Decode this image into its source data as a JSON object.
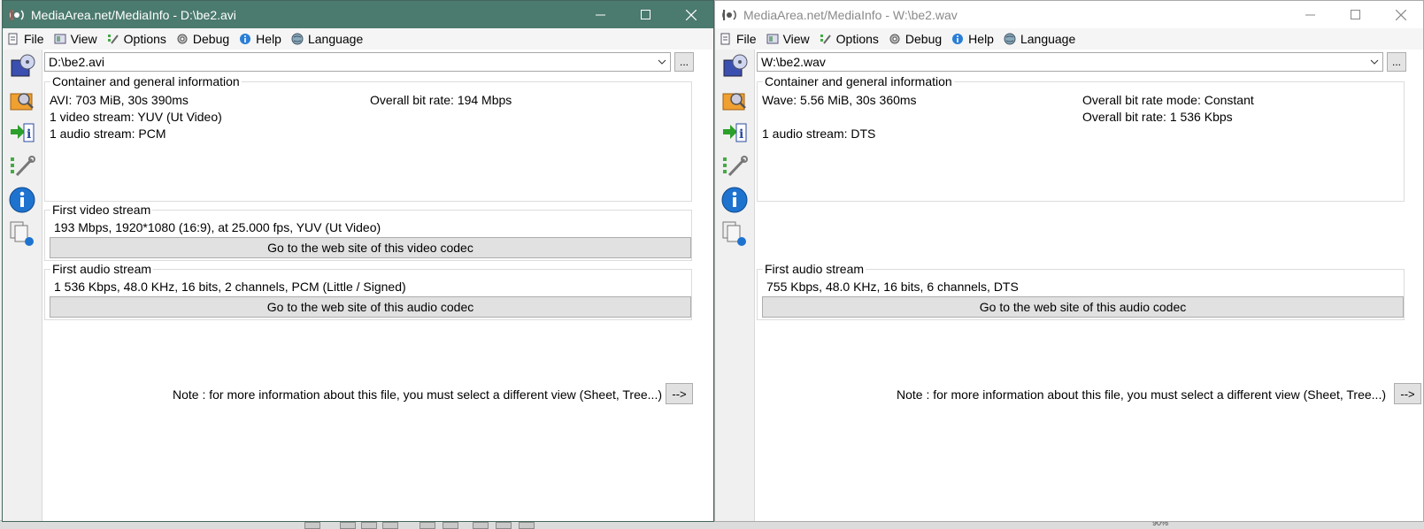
{
  "left_window": {
    "title": "MediaArea.net/MediaInfo - D:\\be2.avi",
    "menu": {
      "file": "File",
      "view": "View",
      "options": "Options",
      "debug": "Debug",
      "help": "Help",
      "language": "Language"
    },
    "file_combo": "D:\\be2.avi",
    "dots": "...",
    "general": {
      "title": "Container and general information",
      "line1": "AVI: 703 MiB, 30s 390ms",
      "line2": "1 video stream: YUV (Ut Video)",
      "line3": "1 audio stream: PCM",
      "right1": "Overall bit rate: 194 Mbps"
    },
    "video": {
      "title": "First video stream",
      "info": "193 Mbps, 1920*1080 (16:9), at 25.000 fps, YUV (Ut Video)",
      "button": "Go to the web site of this video codec"
    },
    "audio": {
      "title": "First audio stream",
      "info": "1 536 Kbps, 48.0 KHz, 16 bits, 2 channels, PCM (Little / Signed)",
      "button": "Go to the web site of this audio codec"
    },
    "note": "Note : for more information about this file, you must select a different view (Sheet, Tree...)",
    "note_button": "-->"
  },
  "right_window": {
    "title": "MediaArea.net/MediaInfo - W:\\be2.wav",
    "menu": {
      "file": "File",
      "view": "View",
      "options": "Options",
      "debug": "Debug",
      "help": "Help",
      "language": "Language"
    },
    "file_combo": "W:\\be2.wav",
    "dots": "...",
    "general": {
      "title": "Container and general information",
      "line1": "Wave: 5.56 MiB, 30s 360ms",
      "line3": "1 audio stream: DTS",
      "right1": "Overall bit rate mode: Constant",
      "right2": "Overall bit rate: 1 536 Kbps"
    },
    "audio": {
      "title": "First audio stream",
      "info": "755 Kbps, 48.0 KHz, 16 bits, 6 channels, DTS",
      "button": "Go to the web site of this audio codec"
    },
    "note": "Note : for more information about this file, you must select a different view (Sheet, Tree...)",
    "note_button": "-->"
  },
  "background": {
    "zoom": "90%"
  },
  "colors": {
    "active_titlebar": "#4b7a6e",
    "inactive_titlebar": "#ffffff",
    "button_face": "#e1e1e1"
  }
}
